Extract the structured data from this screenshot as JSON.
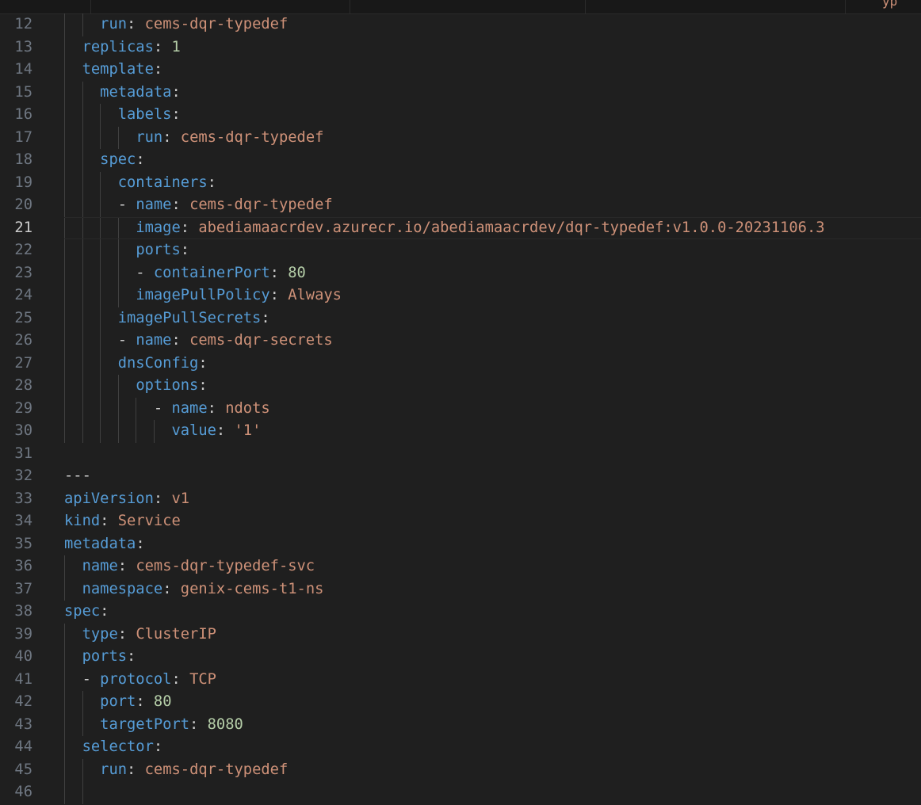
{
  "tab_bar": {
    "label_fragment": "yp"
  },
  "editor": {
    "current_line": 21,
    "lines": [
      {
        "no": 12,
        "indent": "    ",
        "key": "run",
        "value": "cems-dqr-typedef",
        "vtype": "s"
      },
      {
        "no": 13,
        "indent": "  ",
        "key": "replicas",
        "value": "1",
        "vtype": "n"
      },
      {
        "no": 14,
        "indent": "  ",
        "key": "template",
        "value": "",
        "vtype": ""
      },
      {
        "no": 15,
        "indent": "    ",
        "key": "metadata",
        "value": "",
        "vtype": ""
      },
      {
        "no": 16,
        "indent": "      ",
        "key": "labels",
        "value": "",
        "vtype": ""
      },
      {
        "no": 17,
        "indent": "        ",
        "key": "run",
        "value": "cems-dqr-typedef",
        "vtype": "s"
      },
      {
        "no": 18,
        "indent": "    ",
        "key": "spec",
        "value": "",
        "vtype": ""
      },
      {
        "no": 19,
        "indent": "      ",
        "key": "containers",
        "value": "",
        "vtype": ""
      },
      {
        "no": 20,
        "indent": "      - ",
        "key": "name",
        "value": "cems-dqr-typedef",
        "vtype": "s"
      },
      {
        "no": 21,
        "indent": "        ",
        "key": "image",
        "value": "abediamaacrdev.azurecr.io/abediamaacrdev/dqr-typedef:v1.0.0-20231106.3",
        "vtype": "s"
      },
      {
        "no": 22,
        "indent": "        ",
        "key": "ports",
        "value": "",
        "vtype": ""
      },
      {
        "no": 23,
        "indent": "        - ",
        "key": "containerPort",
        "value": "80",
        "vtype": "n"
      },
      {
        "no": 24,
        "indent": "        ",
        "key": "imagePullPolicy",
        "value": "Always",
        "vtype": "s"
      },
      {
        "no": 25,
        "indent": "      ",
        "key": "imagePullSecrets",
        "value": "",
        "vtype": ""
      },
      {
        "no": 26,
        "indent": "      - ",
        "key": "name",
        "value": "cems-dqr-secrets",
        "vtype": "s"
      },
      {
        "no": 27,
        "indent": "      ",
        "key": "dnsConfig",
        "value": "",
        "vtype": ""
      },
      {
        "no": 28,
        "indent": "        ",
        "key": "options",
        "value": "",
        "vtype": ""
      },
      {
        "no": 29,
        "indent": "          - ",
        "key": "name",
        "value": "ndots",
        "vtype": "s"
      },
      {
        "no": 30,
        "indent": "            ",
        "key": "value",
        "value": "'1'",
        "vtype": "s"
      },
      {
        "no": 31,
        "indent": "",
        "key": "",
        "value": "",
        "vtype": ""
      },
      {
        "no": 32,
        "indent": "",
        "key": "",
        "value": "---",
        "vtype": "p",
        "raw": true
      },
      {
        "no": 33,
        "indent": "",
        "key": "apiVersion",
        "value": "v1",
        "vtype": "s"
      },
      {
        "no": 34,
        "indent": "",
        "key": "kind",
        "value": "Service",
        "vtype": "s"
      },
      {
        "no": 35,
        "indent": "",
        "key": "metadata",
        "value": "",
        "vtype": ""
      },
      {
        "no": 36,
        "indent": "  ",
        "key": "name",
        "value": "cems-dqr-typedef-svc",
        "vtype": "s"
      },
      {
        "no": 37,
        "indent": "  ",
        "key": "namespace",
        "value": "genix-cems-t1-ns",
        "vtype": "s"
      },
      {
        "no": 38,
        "indent": "",
        "key": "spec",
        "value": "",
        "vtype": ""
      },
      {
        "no": 39,
        "indent": "  ",
        "key": "type",
        "value": "ClusterIP",
        "vtype": "s"
      },
      {
        "no": 40,
        "indent": "  ",
        "key": "ports",
        "value": "",
        "vtype": ""
      },
      {
        "no": 41,
        "indent": "  - ",
        "key": "protocol",
        "value": "TCP",
        "vtype": "s"
      },
      {
        "no": 42,
        "indent": "    ",
        "key": "port",
        "value": "80",
        "vtype": "n"
      },
      {
        "no": 43,
        "indent": "    ",
        "key": "targetPort",
        "value": "8080",
        "vtype": "n"
      },
      {
        "no": 44,
        "indent": "  ",
        "key": "selector",
        "value": "",
        "vtype": ""
      },
      {
        "no": 45,
        "indent": "    ",
        "key": "run",
        "value": "cems-dqr-typedef",
        "vtype": "s"
      },
      {
        "no": 46,
        "indent": "",
        "key": "",
        "value": "",
        "vtype": ""
      }
    ]
  },
  "colors": {
    "background": "#1f1f1f",
    "key": "#569cd6",
    "string": "#ce9178",
    "number": "#b5cea8",
    "line_number": "#6e7681",
    "line_number_active": "#cccccc",
    "indent_guide": "#404040"
  }
}
